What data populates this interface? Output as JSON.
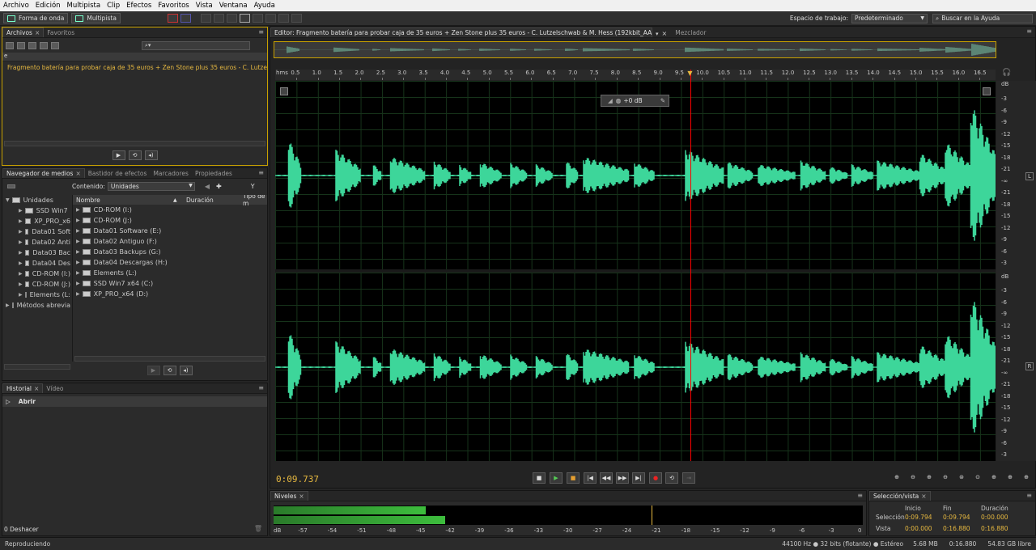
{
  "menu": [
    "Archivo",
    "Edición",
    "Multipista",
    "Clip",
    "Efectos",
    "Favoritos",
    "Vista",
    "Ventana",
    "Ayuda"
  ],
  "toolbar": {
    "waveform": "Forma de onda",
    "multitrack": "Multipista",
    "workspace_label": "Espacio de trabajo:",
    "workspace_value": "Predeterminado",
    "search_placeholder": "Buscar en la Ayuda"
  },
  "files_panel": {
    "tabs": [
      "Archivos",
      "Favoritos"
    ],
    "col": "e",
    "file": "Fragmento batería para probar caja de 35 euros + Zen Stone plus 35 euros - C. Lutzelschwab & M. Hess (192kbit_AAC).m4a"
  },
  "media_panel": {
    "tabs": [
      "Navegador de medios",
      "Bastidor de efectos",
      "Marcadores",
      "Propiedades"
    ],
    "contents_label": "Contenido:",
    "contents_value": "Unidades",
    "tree_root": "Unidades",
    "tree": [
      "SSD Win7",
      "XP_PRO_x6",
      "Data01 Soft",
      "Data02 Anti",
      "Data03 Bac",
      "Data04 Des",
      "CD-ROM (I:)",
      "CD-ROM (J:)",
      "Elements (L:)"
    ],
    "shortcuts": "Métodos abreviados",
    "cols": [
      "Nombre",
      "Duración",
      "Tipo de m"
    ],
    "list": [
      "CD-ROM (I:)",
      "CD-ROM (J:)",
      "Data01 Software (E:)",
      "Data02 Antiguo (F:)",
      "Data03 Backups (G:)",
      "Data04 Descargas (H:)",
      "Elements (L:)",
      "SSD Win7 x64 (C:)",
      "XP_PRO_x64 (D:)"
    ]
  },
  "history_panel": {
    "tabs": [
      "Historial",
      "Vídeo"
    ],
    "item": "Abrir",
    "undo": "0 Deshacer"
  },
  "editor": {
    "tab": "Editor: Fragmento batería para probar caja de 35 euros + Zen Stone plus 35 euros - C. Lutzelschwab & M. Hess (192kbit_AAC).m4a",
    "mixer": "Mezclador",
    "time": "0:09.737",
    "gain": "+0 dB",
    "ruler_unit": "hms",
    "channel_left": "L",
    "channel_right": "R",
    "db_unit": "dB",
    "ticks": [
      "0.5",
      "1.0",
      "1.5",
      "2.0",
      "2.5",
      "3.0",
      "3.5",
      "4.0",
      "4.5",
      "5.0",
      "5.5",
      "6.0",
      "6.5",
      "7.0",
      "7.5",
      "8.0",
      "8.5",
      "9.0",
      "9.5",
      "10.0",
      "10.5",
      "11.0",
      "11.5",
      "12.0",
      "12.5",
      "13.0",
      "13.5",
      "14.0",
      "14.5",
      "15.0",
      "15.5",
      "16.0",
      "16.5"
    ],
    "db_scale": [
      "-3",
      "-6",
      "-9",
      "-12",
      "-15",
      "-18",
      "-21",
      "-∞",
      "-21",
      "-18",
      "-15",
      "-12",
      "-9",
      "-6",
      "-3"
    ],
    "playhead_seconds": 9.737,
    "duration_seconds": 16.88,
    "wave_color": "#3dd69a",
    "playhead_color": "#ff0000"
  },
  "levels": {
    "tab": "Niveles",
    "scale": [
      "dB",
      "-57",
      "-54",
      "-51",
      "-48",
      "-45",
      "-42",
      "-39",
      "-36",
      "-33",
      "-30",
      "-27",
      "-24",
      "-21",
      "-18",
      "-15",
      "-12",
      "-9",
      "-6",
      "-3",
      "0"
    ],
    "left_db": -44.5,
    "right_db": -42.5,
    "peak_db": -21.5
  },
  "selview": {
    "tab": "Selección/vista",
    "headers": [
      "Inicio",
      "Fin",
      "Duración"
    ],
    "rows": [
      {
        "label": "Selección",
        "start": "0:09.794",
        "end": "0:09.794",
        "dur": "0:00.000"
      },
      {
        "label": "Vista",
        "start": "0:00.000",
        "end": "0:16.880",
        "dur": "0:16.880"
      }
    ]
  },
  "status": {
    "left": "Reproduciendo",
    "format": "44100 Hz ● 32 bits (flotante) ● Estéreo",
    "size": "5.68 MB",
    "dur": "0:16.880",
    "free": "54.83 GB libre"
  }
}
